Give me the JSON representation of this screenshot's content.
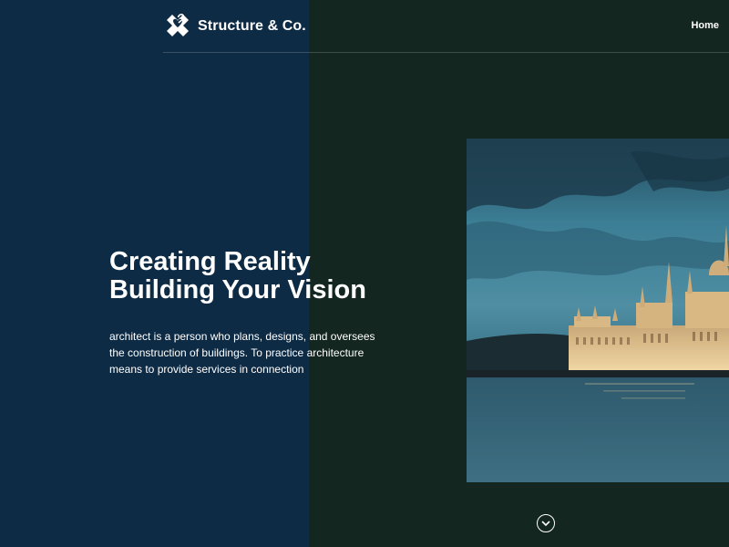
{
  "header": {
    "brand": "Structure & Co.",
    "logo_icon": "x-heart-logo-icon",
    "nav": [
      {
        "label": "Home"
      }
    ]
  },
  "hero": {
    "title_line1": "Creating Reality",
    "title_line2": "Building Your Vision",
    "description": "architect is a person who plans, designs, and oversees the construction of buildings. To practice architecture means to provide services in connection"
  },
  "scroll": {
    "icon": "chevron-down-icon"
  },
  "colors": {
    "left_panel": "#0e2b45",
    "right_panel": "#13261f",
    "text": "#ffffff"
  }
}
